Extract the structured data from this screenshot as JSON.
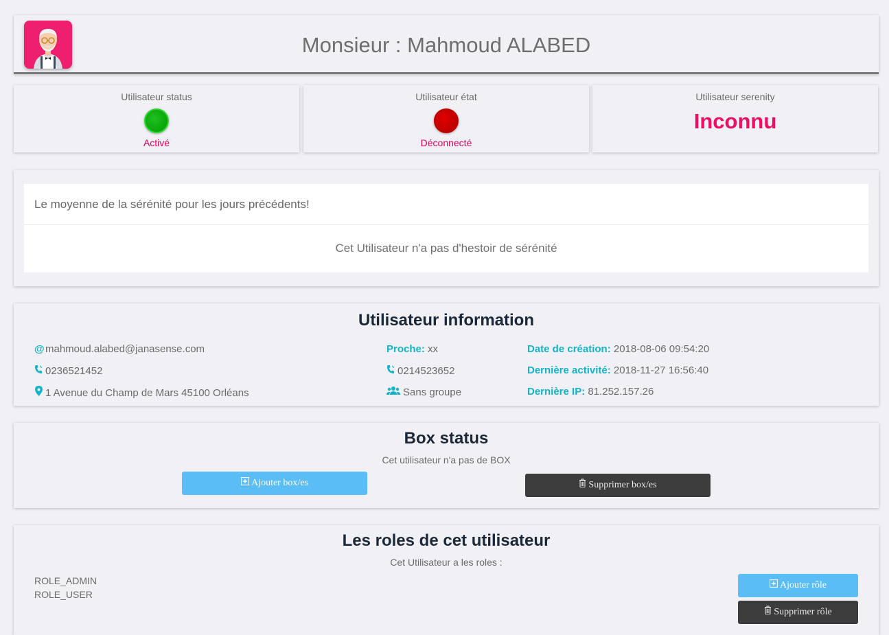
{
  "header": {
    "title": "Monsieur : Mahmoud ALABED",
    "avatar_icon": "user-avatar-icon"
  },
  "status_cards": [
    {
      "label": "Utilisateur status",
      "value": "Activé",
      "indicator_color": "#00a800"
    },
    {
      "label": "Utilisateur état",
      "value": "Déconnecté",
      "indicator_color": "#cc0000"
    },
    {
      "label": "Utilisateur serenity",
      "value": "Inconnu"
    }
  ],
  "serenity_history": {
    "title": "Le moyenne de la sérénité pour les jours précédents!",
    "empty_message": "Cet Utilisateur n'a pas d'hestoir de sérénité"
  },
  "info": {
    "title": "Utilisateur information",
    "email": "mahmoud.alabed@janasense.com",
    "phone": "0236521452",
    "address": "1 Avenue du Champ de Mars 45100 Orléans",
    "proche_label": "Proche:",
    "proche_value": "xx",
    "proche_phone": "0214523652",
    "group": "Sans groupe",
    "creation_label": "Date de création:",
    "creation_value": "2018-08-06 09:54:20",
    "activity_label": "Dernière activité:",
    "activity_value": "2018-11-27 16:56:40",
    "ip_label": "Dernière IP:",
    "ip_value": "81.252.157.26"
  },
  "box_status": {
    "title": "Box status",
    "message": "Cet utilisateur n'a pas de BOX",
    "add_label": "Ajouter box/es",
    "delete_label": "Supprimer box/es"
  },
  "roles": {
    "title": "Les roles de cet utilisateur",
    "message": "Cet Utilisateur a les roles :",
    "items": [
      "ROLE_ADMIN",
      "ROLE_USER"
    ],
    "add_label": "Ajouter rôle",
    "delete_label": "Supprimer rôle"
  },
  "colors": {
    "accent": "#13b3c8",
    "alert": "#ee0e63",
    "button_blue": "#5bbdf5",
    "button_dark": "#3c3c3c",
    "heading": "#1b2838"
  }
}
